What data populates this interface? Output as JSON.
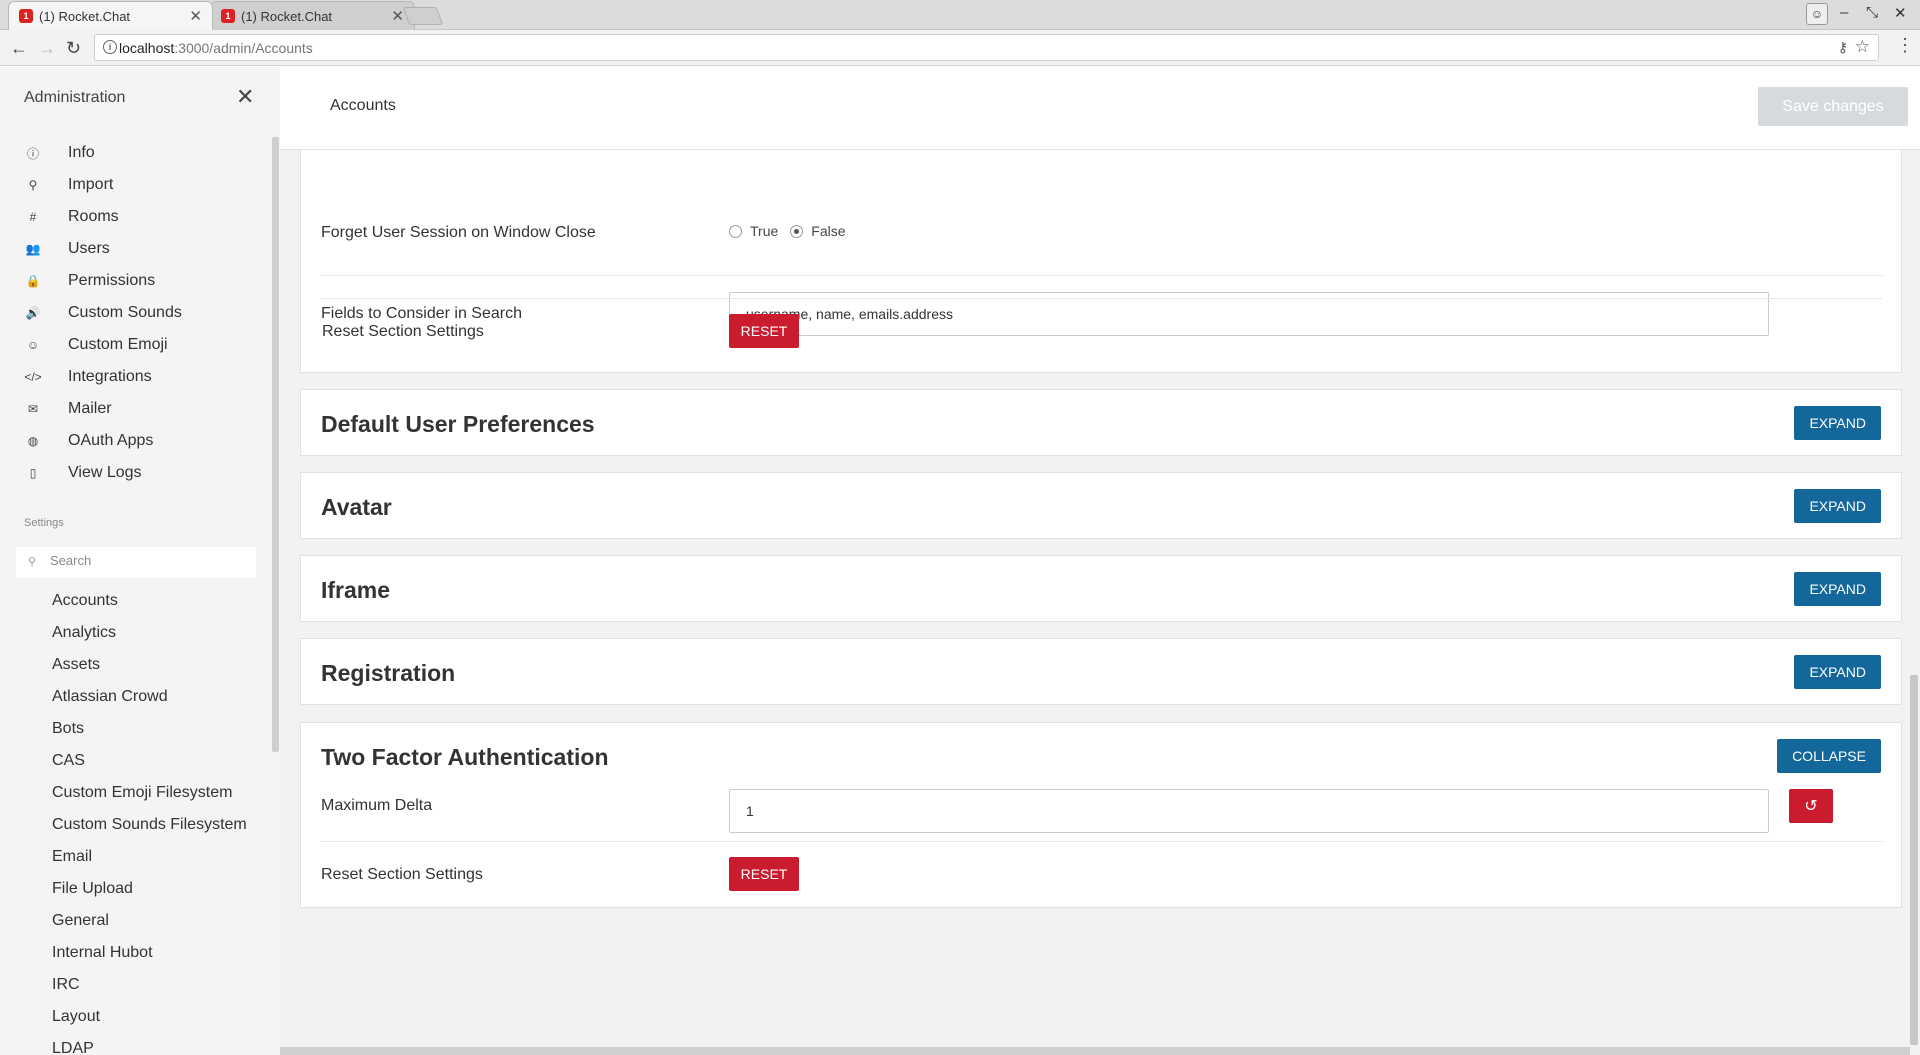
{
  "browser": {
    "tabs": [
      {
        "title": "(1) Rocket.Chat",
        "active": true
      },
      {
        "title": "(1) Rocket.Chat",
        "active": false
      }
    ],
    "url_host": "localhost",
    "url_path": ":3000/admin/Accounts"
  },
  "sidebar": {
    "title": "Administration",
    "admin_items": [
      {
        "label": "Info",
        "icon": "info-icon"
      },
      {
        "label": "Import",
        "icon": "import-icon"
      },
      {
        "label": "Rooms",
        "icon": "hashtag-icon"
      },
      {
        "label": "Users",
        "icon": "users-icon"
      },
      {
        "label": "Permissions",
        "icon": "lock-icon"
      },
      {
        "label": "Custom Sounds",
        "icon": "volume-icon"
      },
      {
        "label": "Custom Emoji",
        "icon": "emoji-icon"
      },
      {
        "label": "Integrations",
        "icon": "code-icon"
      },
      {
        "label": "Mailer",
        "icon": "mail-icon"
      },
      {
        "label": "OAuth Apps",
        "icon": "globe-icon"
      },
      {
        "label": "View Logs",
        "icon": "file-icon"
      }
    ],
    "settings_heading": "Settings",
    "search_placeholder": "Search",
    "settings_items": [
      "Accounts",
      "Analytics",
      "Assets",
      "Atlassian Crowd",
      "Bots",
      "CAS",
      "Custom Emoji Filesystem",
      "Custom Sounds Filesystem",
      "Email",
      "File Upload",
      "General",
      "Internal Hubot",
      "IRC",
      "Layout",
      "LDAP"
    ]
  },
  "main": {
    "title": "Accounts",
    "save_label": "Save changes",
    "top_section": {
      "forget_label": "Forget User Session on Window Close",
      "radio_true": "True",
      "radio_false": "False",
      "radio_selected": "False",
      "fields_label": "Fields to Consider in Search",
      "fields_value": "username, name, emails.address",
      "reset_label": "Reset Section Settings",
      "reset_button": "RESET"
    },
    "panels": [
      {
        "title": "Default User Preferences",
        "button": "EXPAND"
      },
      {
        "title": "Avatar",
        "button": "EXPAND"
      },
      {
        "title": "Iframe",
        "button": "EXPAND"
      },
      {
        "title": "Registration",
        "button": "EXPAND"
      }
    ],
    "two_factor": {
      "title": "Two Factor Authentication",
      "button": "COLLAPSE",
      "max_delta_label": "Maximum Delta",
      "max_delta_value": "1",
      "reset_label": "Reset Section Settings",
      "reset_button": "RESET"
    }
  }
}
